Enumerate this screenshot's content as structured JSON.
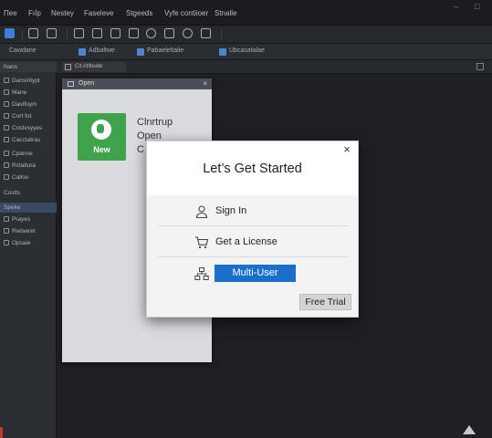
{
  "menu": {
    "items": [
      "Пее",
      "Fıİp",
      "Nestey",
      "Faseleve",
      "Stgeeds",
      "Vyfe contiioer",
      "Stnalle"
    ],
    "window_controls": [
      "–",
      "□"
    ]
  },
  "toolbar": {
    "icons": [
      "save-icon",
      "copy-icon",
      "undo-icon",
      "frame-icon",
      "grid-icon",
      "shape-icon",
      "layer-icon",
      "circle-icon",
      "link-icon",
      "box-icon",
      "globe-icon"
    ],
    "accent": "#3c7fd6"
  },
  "toolbar2": {
    "items": [
      "Cawdane",
      "Adbaltwe",
      "Pabaeleltalie",
      "Ubcasatalae"
    ]
  },
  "doc_tab": {
    "label": "Cit Atllteate"
  },
  "sidebar": {
    "rows": [
      "Nans",
      "Dansiritypt",
      "Mane",
      "Dastfoym",
      "Cort fot",
      "Costvsyyes",
      "Cacctatras",
      "Cpanne",
      "Rctaltura",
      "Calloo",
      "Costls",
      "Speke",
      "Prayes",
      "Rwlaeret",
      "Opsaie"
    ]
  },
  "open_panel": {
    "title": "Open",
    "new_tile_label": "New",
    "new_tile_color": "#3ea34a",
    "lines": [
      "Clnrtrup",
      "Open",
      "C"
    ]
  },
  "modal": {
    "title": "Let’s Get Started",
    "close": "×",
    "options": [
      {
        "label": "Sign In",
        "icon": "user-icon"
      },
      {
        "label": "Get a License",
        "icon": "cart-icon"
      },
      {
        "label": "Multi-User",
        "icon": "network-icon"
      }
    ],
    "trial_label": "Free Trial",
    "accent": "#1a6fc9"
  }
}
